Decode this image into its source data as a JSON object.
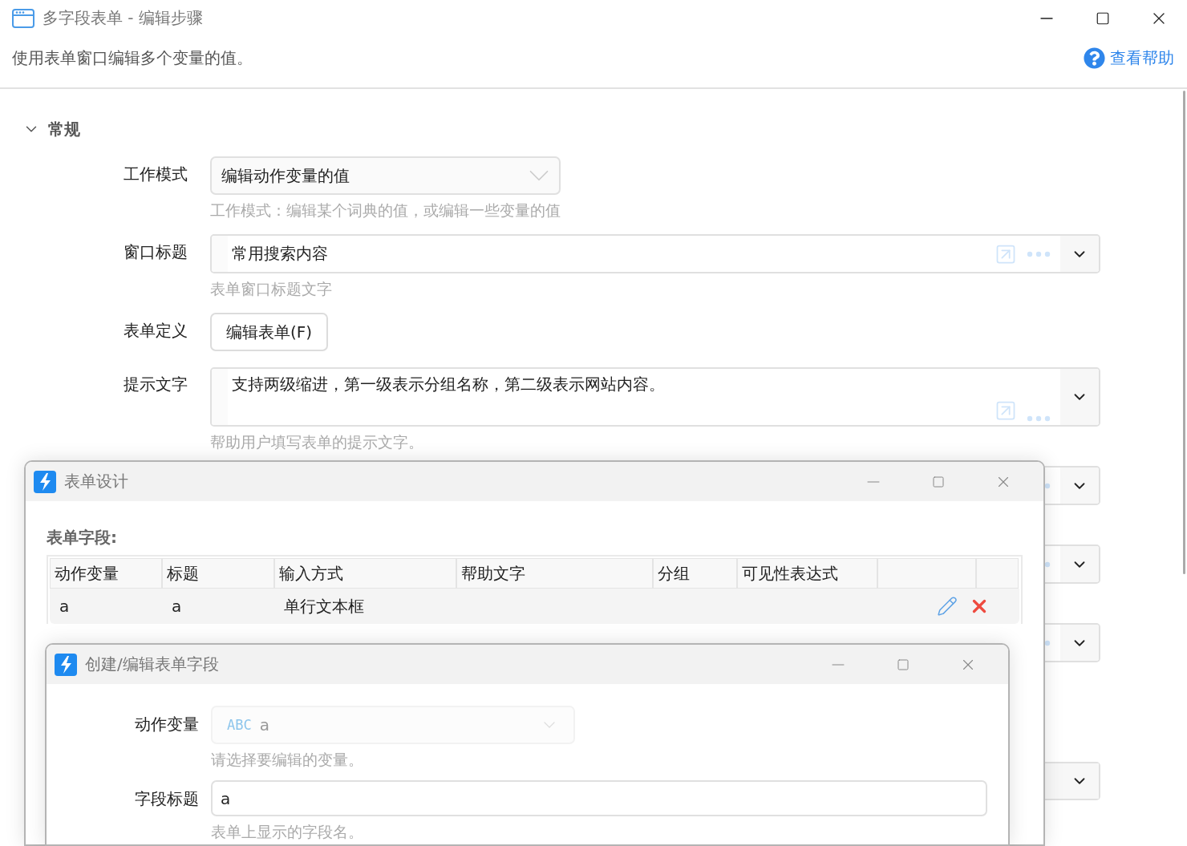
{
  "window": {
    "title": "多字段表单 - 编辑步骤"
  },
  "description": "使用表单窗口编辑多个变量的值。",
  "help_link": "查看帮助",
  "section": {
    "title": "常规",
    "expanded": true
  },
  "fields": [
    {
      "kind": "select",
      "label": "工作模式",
      "value": "编辑动作变量的值",
      "hint": "工作模式：编辑某个词典的值，或编辑一些变量的值"
    },
    {
      "kind": "expression",
      "label": "窗口标题",
      "value": "常用搜索内容",
      "hint": "表单窗口标题文字"
    },
    {
      "kind": "button",
      "label": "表单定义",
      "value": "编辑表单(F)"
    },
    {
      "kind": "multiline",
      "label": "提示文字",
      "value": "支持两级缩进，第一级表示分组名称，第二级表示网站内容。",
      "hint": "帮助用户填写表单的提示文字。"
    },
    {
      "kind": "expression"
    },
    {
      "kind": "expression"
    },
    {
      "kind": "expression"
    },
    {
      "kind": "dropdown"
    }
  ],
  "form_designer": {
    "title": "表单设计",
    "section_label": "表单字段:",
    "columns": [
      "动作变量",
      "标题",
      "输入方式",
      "帮助文字",
      "分组",
      "可见性表达式"
    ],
    "rows": [
      {
        "cells": [
          "a",
          "a",
          "单行文本框"
        ]
      }
    ]
  },
  "field_editor": {
    "title": "创建/编辑表单字段",
    "fields": [
      {
        "kind": "variable-select",
        "label": "动作变量",
        "type_badge": "ABC",
        "value": "a",
        "hint": "请选择要编辑的变量。",
        "disabled": true
      },
      {
        "kind": "text",
        "label": "字段标题",
        "value": "a",
        "hint": "表单上显示的字段名。"
      }
    ]
  }
}
